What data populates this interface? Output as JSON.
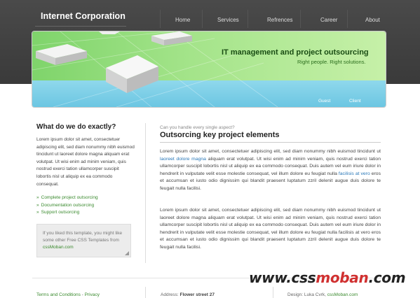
{
  "header": {
    "logo": "Internet Corporation",
    "nav": [
      "Home",
      "Services",
      "Refrences",
      "Career",
      "About"
    ]
  },
  "banner": {
    "title": "IT management and project outsourcing",
    "subtitle": "Right people. Right solutions.",
    "links": [
      "Guest",
      "Client"
    ]
  },
  "sidebar": {
    "title": "What do we do exactly?",
    "text": "Lorem ipsum dolor sit amet, consectetuer adipiscing elit, sed diam nonummy nibh euismod tincidunt ut laoreet dolore magna aliquam erat volutpat. Ut wisi enim ad minim veniam, quis nostrud exerci tation ullamcorper suscipit lobortis nisl ut aliquip ex ea commodo consequat.",
    "links": [
      "Complete project outsorcing",
      "Documentation outsorcing",
      "Support outsorcing"
    ],
    "box_text": "If you liked this template, you might like some other Free CSS Templates from",
    "box_link": "cssMoban.com"
  },
  "main": {
    "kicker": "Can you handle every single aspect?",
    "title": "Outsorcing key project elements",
    "p1_a": "Lorem ipsum dolor sit amet, consectetuer adipiscing elit, sed diam nonummy nibh euismod tincidunt ut",
    "p1_link1": "laoreet dolore magna",
    "p1_b": "aliquam erat volutpat. Ut wisi enim ad minim veniam, quis nostrud exerci tation ullamcorper suscipit lobortis nisl ut aliquip ex ea commodo consequat. Duis autem vel eum iriure dolor in hendrerit in vulputate velit esse molestie consequat, vel illum dolore eu feugiat nulla",
    "p1_link2": "facilisis at vero",
    "p1_c": "eros et accumsan et iusto odio dignissim qui blandit praesent luptatum zzril delenit augue duis dolore te feugait nulla facilisi.",
    "p2": "Lorem ipsum dolor sit amet, consectetuer adipiscing elit, sed diam nonummy nibh euismod tincidunt ut laoreet dolore magna aliquam erat volutpat. Ut wisi enim ad minim veniam, quis nostrud exerci tation ullamcorper suscipit lobortis nisl ut aliquip ex ea commodo consequat. Duis autem vel eum iriure dolor in hendrerit in vulputate velit esse molestie consequat, vel illum dolore eu feugiat nulla facilisis at vero eros et accumsan et iusto odio dignissim qui blandit praesent luptatum zzril delenit augue duis dolore te feugait nulla facilisi."
  },
  "footer": {
    "terms": "Terms and Conditions",
    "sep": " - ",
    "privacy": "Privacy",
    "address_label": "Address:",
    "address_value": "Flower street 27",
    "design_label": "Design:",
    "design_author": "Luka Cvrk,",
    "design_link": "cssMoban.com"
  },
  "watermark": {
    "part1": "www.css",
    "part2": "moban",
    "part3": ".com"
  }
}
